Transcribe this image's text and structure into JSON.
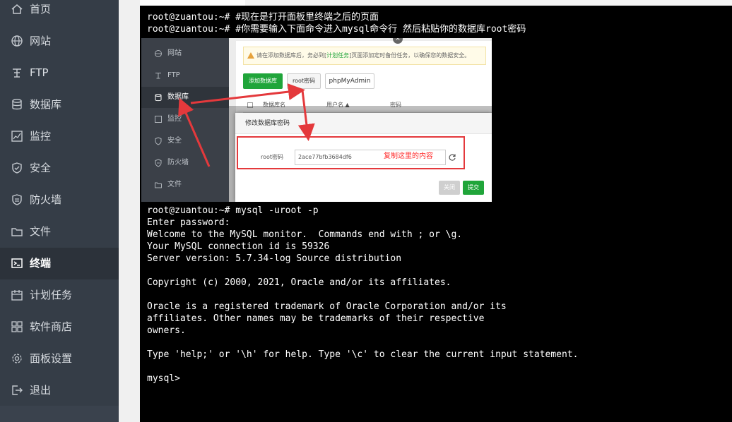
{
  "sidebar": {
    "items": [
      {
        "label": "首页",
        "icon": "home-icon",
        "active": false
      },
      {
        "label": "网站",
        "icon": "globe-icon",
        "active": false
      },
      {
        "label": "FTP",
        "icon": "ftp-icon",
        "active": false
      },
      {
        "label": "数据库",
        "icon": "database-icon",
        "active": false
      },
      {
        "label": "监控",
        "icon": "monitor-icon",
        "active": false
      },
      {
        "label": "安全",
        "icon": "shield-icon",
        "active": false
      },
      {
        "label": "防火墙",
        "icon": "firewall-icon",
        "active": false
      },
      {
        "label": "文件",
        "icon": "folder-icon",
        "active": false
      },
      {
        "label": "终端",
        "icon": "terminal-icon",
        "active": true
      },
      {
        "label": "计划任务",
        "icon": "calendar-icon",
        "active": false
      },
      {
        "label": "软件商店",
        "icon": "grid-icon",
        "active": false
      },
      {
        "label": "面板设置",
        "icon": "gear-icon",
        "active": false
      },
      {
        "label": "退出",
        "icon": "logout-icon",
        "active": false
      }
    ]
  },
  "terminal": {
    "top_lines": [
      "root@zuantou:~# #现在是打开面板里终端之后的页面",
      "root@zuantou:~# #你需要输入下面命令进入mysql命令行 然后粘贴你的数据库root密码"
    ],
    "bottom_lines": [
      "root@zuantou:~# mysql -uroot -p",
      "Enter password:",
      "Welcome to the MySQL monitor.  Commands end with ; or \\g.",
      "Your MySQL connection id is 59326",
      "Server version: 5.7.34-log Source distribution",
      "",
      "Copyright (c) 2000, 2021, Oracle and/or its affiliates.",
      "",
      "Oracle is a registered trademark of Oracle Corporation and/or its",
      "affiliates. Other names may be trademarks of their respective",
      "owners.",
      "",
      "Type 'help;' or '\\h' for help. Type '\\c' to clear the current input statement.",
      "",
      "mysql>"
    ]
  },
  "embedded_panel": {
    "sidebar": [
      {
        "label": "网站",
        "icon": "globe-icon",
        "active": false
      },
      {
        "label": "FTP",
        "icon": "ftp-icon",
        "active": false
      },
      {
        "label": "数据库",
        "icon": "database-icon",
        "active": true
      },
      {
        "label": "监控",
        "icon": "monitor-icon",
        "active": false
      },
      {
        "label": "安全",
        "icon": "shield-icon",
        "active": false
      },
      {
        "label": "防火墙",
        "icon": "firewall-icon",
        "active": false
      },
      {
        "label": "文件",
        "icon": "folder-icon",
        "active": false
      }
    ],
    "warning_prefix": "请在添加数据库后，务必到[",
    "warning_link": "计划任务",
    "warning_suffix": "]页面添加定时备份任务，以确保您的数据安全。",
    "add_db_button": "添加数据库",
    "root_password_button": "root密码",
    "phpmyadmin_button": "phpMyAdmin",
    "table_headers": [
      "数据库名",
      "用户名 ▲",
      "密码"
    ],
    "dialog": {
      "title": "修改数据库密码",
      "close": "×",
      "field_label": "root密码",
      "field_value": "2ace77bfb3684df6",
      "note": "复制这里的内容",
      "cancel_button": "关闭",
      "submit_button": "提交"
    },
    "colors": {
      "accent_green": "#20a53a",
      "annotation_red": "#e4393c"
    }
  }
}
